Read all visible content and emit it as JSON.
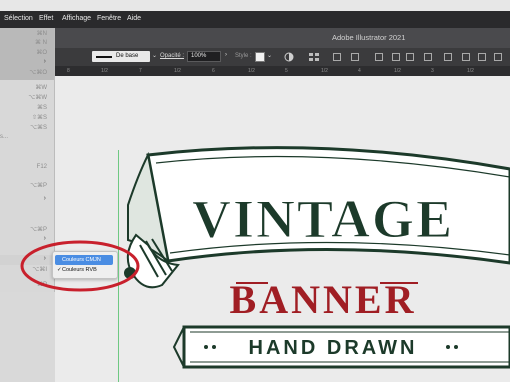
{
  "menubar": {
    "items": [
      "Sélection",
      "Effet",
      "Affichage",
      "Fenêtre",
      "Aide"
    ]
  },
  "window": {
    "title": "Adobe Illustrator 2021"
  },
  "control_bar": {
    "stroke_style": "De base",
    "opacity_label": "Opacité :",
    "opacity_value": "100%",
    "style_label": "Style :"
  },
  "ruler": {
    "ticks": [
      "8",
      "1/2",
      "7",
      "1/2",
      "6",
      "1/2",
      "5",
      "1/2",
      "4",
      "1/2",
      "3",
      "1/2"
    ]
  },
  "left_menu": {
    "shortcuts": [
      "⌘N",
      "⌘ N",
      "⌘O",
      "⌘O",
      "⌥⌘O",
      "⌘W",
      "⌥⌘W",
      "⌘S",
      "⇧⌘S",
      "⌥⌘S",
      "F12",
      "⌥⌘P",
      "⌥⌘P",
      "⌥⌘I",
      "⌘P"
    ],
    "truncated_text": "s..."
  },
  "submenu": {
    "items": [
      {
        "label": "Couleurs CMJN",
        "checked": false,
        "highlighted": true
      },
      {
        "label": "Couleurs RVB",
        "checked": true,
        "highlighted": false
      }
    ],
    "check_glyph": "✓"
  },
  "artwork": {
    "line1": "VINTAGE",
    "line2": "BANNER",
    "line3": "HAND DRAWN",
    "colors": {
      "green": "#1c3a2a",
      "red": "#a01e24",
      "paper": "#ffffff"
    }
  },
  "annotation": {
    "circle_color": "#c8202c"
  },
  "colors": {
    "menubar_dark": "#2a2a2c",
    "titlebar": "#4a4a4d",
    "controlbar": "#3b3b3d",
    "selection_blue": "#4a8de3"
  }
}
